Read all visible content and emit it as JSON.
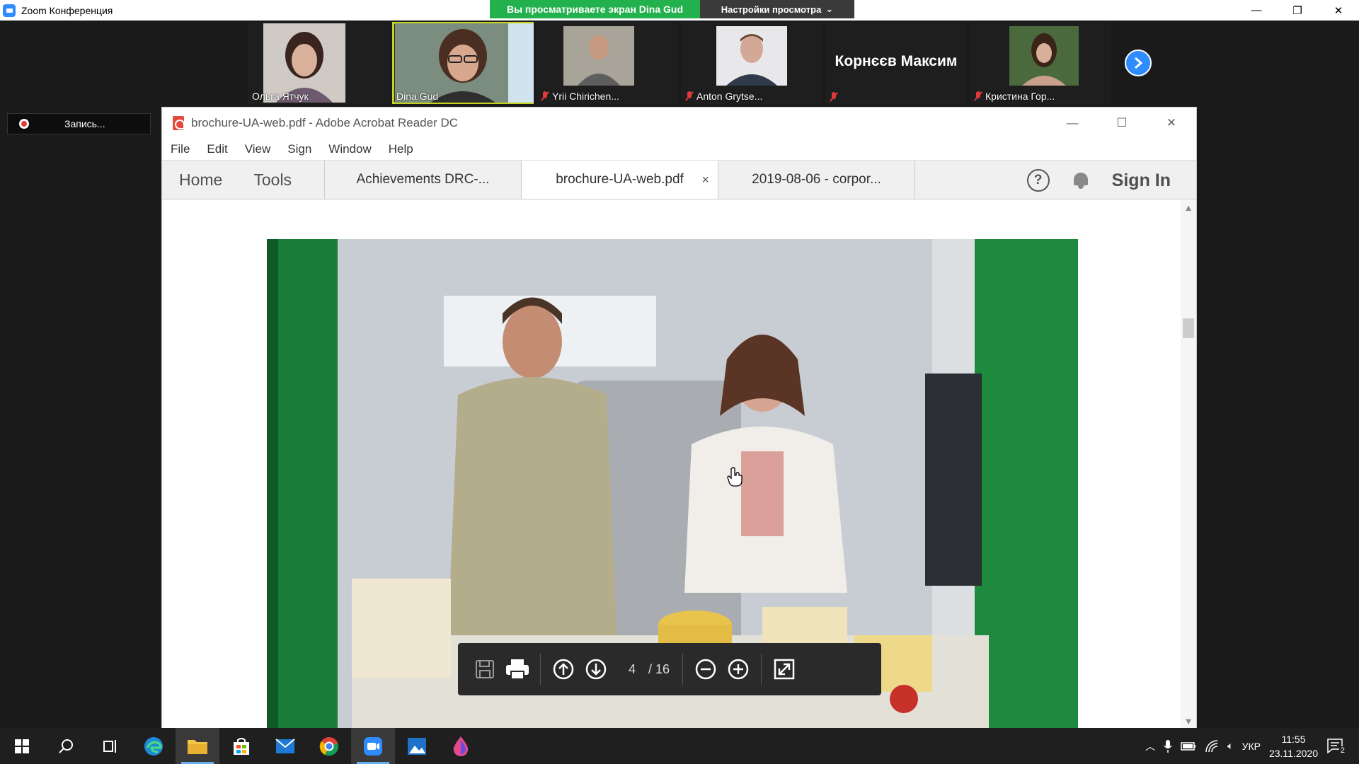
{
  "zoom": {
    "title": "Zoom Конференция",
    "share_banner": "Вы просматриваете экран Dina Gud",
    "view_settings": "Настройки просмотра",
    "record_label": "Запись..."
  },
  "participants": [
    {
      "name": "Ольга Ятчук",
      "muted": false,
      "active": false
    },
    {
      "name": "Dina Gud",
      "muted": false,
      "active": true
    },
    {
      "name": "Yrii Chirichen...",
      "muted": true,
      "active": false
    },
    {
      "name": "Anton Grytse...",
      "muted": true,
      "active": false
    },
    {
      "name": "Корнєєв Максим",
      "muted": true,
      "active": false
    },
    {
      "name": "Кристина Гор...",
      "muted": true,
      "active": false
    }
  ],
  "acrobat": {
    "title": "brochure-UA-web.pdf - Adobe Acrobat Reader DC",
    "menu": [
      "File",
      "Edit",
      "View",
      "Sign",
      "Window",
      "Help"
    ],
    "home": "Home",
    "tools": "Tools",
    "tabs": [
      {
        "label": "Achievements DRC-...",
        "active": false
      },
      {
        "label": "brochure-UA-web.pdf",
        "active": true
      },
      {
        "label": "2019-08-06 - corpor...",
        "active": false
      }
    ],
    "tab_close": "×",
    "help": "?",
    "sign_in": "Sign In",
    "current_page": "4",
    "total_pages": "/ 16"
  },
  "taskbar": {
    "language": "УКР",
    "time": "11:55",
    "date": "23.11.2020",
    "notifications": "2"
  },
  "colors": {
    "zoom_blue": "#2d8cff",
    "share_green": "#22b14c",
    "active_speaker": "#c6d31f",
    "acrobat_red": "#e5483c"
  }
}
